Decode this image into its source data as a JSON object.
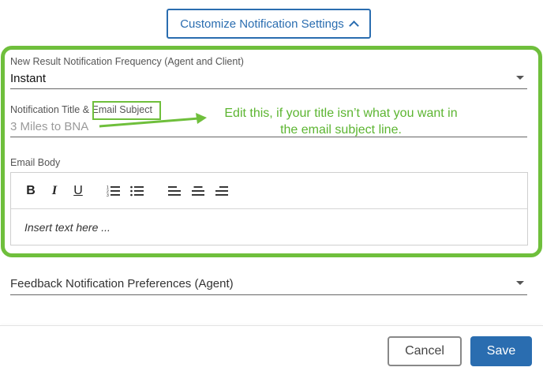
{
  "customize": {
    "label": "Customize Notification Settings",
    "icon": "chevron-up-icon"
  },
  "frequency": {
    "label": "New Result Notification Frequency (Agent and Client)",
    "value": "Instant"
  },
  "title_field": {
    "label_prefix": "Notification Title & ",
    "label_highlight": "Email Subject",
    "value": "3 Miles to BNA"
  },
  "annotation": {
    "line1": "Edit this, if your title isn’t what you want in",
    "line2": "the email subject line."
  },
  "email_body": {
    "label": "Email Body",
    "placeholder": "Insert text here ...",
    "toolbar": {
      "bold": "B",
      "italic": "I",
      "underline": "U"
    }
  },
  "feedback": {
    "label": "Feedback Notification Preferences (Agent)"
  },
  "footer": {
    "cancel_label": "Cancel",
    "save_label": "Save"
  },
  "colors": {
    "accent": "#2a6db0",
    "highlight": "#6fbf3c"
  }
}
